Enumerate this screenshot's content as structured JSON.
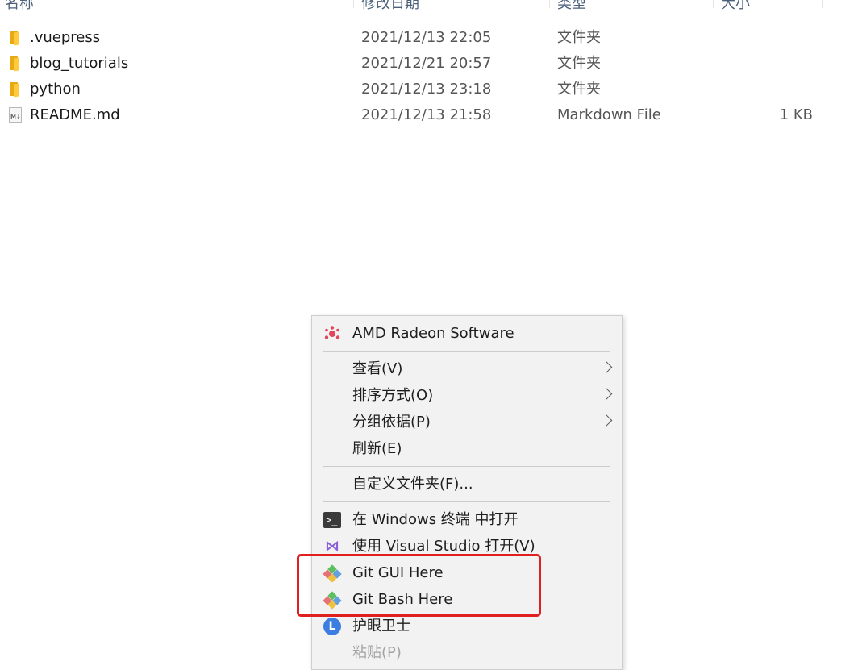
{
  "columns": {
    "name": "名称",
    "date": "修改日期",
    "type": "类型",
    "size": "大小"
  },
  "files": [
    {
      "name": ".vuepress",
      "date": "2021/12/13 22:05",
      "type": "文件夹",
      "size": "",
      "icon": "folder-icon"
    },
    {
      "name": "blog_tutorials",
      "date": "2021/12/21 20:57",
      "type": "文件夹",
      "size": "",
      "icon": "folder-icon"
    },
    {
      "name": "python",
      "date": "2021/12/13 23:18",
      "type": "文件夹",
      "size": "",
      "icon": "folder-icon"
    },
    {
      "name": "README.md",
      "date": "2021/12/13 21:58",
      "type": "Markdown File",
      "size": "1 KB",
      "icon": "markdown-file-icon"
    }
  ],
  "context_menu": {
    "amd": "AMD Radeon Software",
    "view": "查看(V)",
    "sort": "排序方式(O)",
    "group": "分组依据(P)",
    "refresh": "刷新(E)",
    "customize": "自定义文件夹(F)...",
    "terminal": "在 Windows 终端 中打开",
    "visual_studio": "使用 Visual Studio 打开(V)",
    "git_gui": "Git GUI Here",
    "git_bash": "Git Bash Here",
    "eye_guard": "护眼卫士",
    "paste": "粘贴(P)"
  },
  "icon_glyphs": {
    "markdown": "M↓",
    "terminal": ">_",
    "visual_studio": "⋈",
    "eye_guard": "L"
  },
  "colors": {
    "highlight": "#e02020",
    "folder": "#ffcb3d",
    "menu_bg": "#f2f2f2"
  }
}
